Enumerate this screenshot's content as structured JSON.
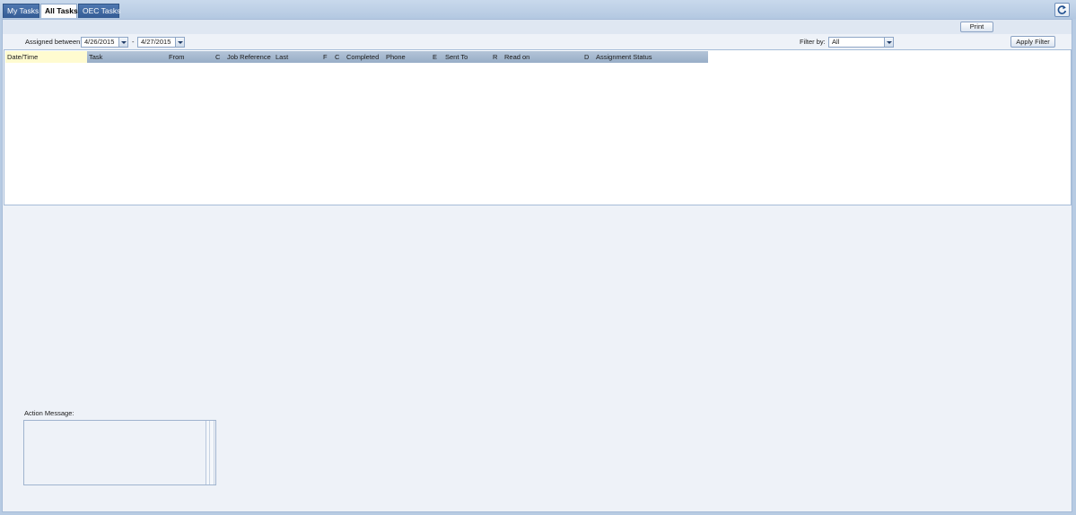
{
  "tabs": [
    {
      "label": "My Tasks",
      "active": false
    },
    {
      "label": "All Tasks",
      "active": true
    },
    {
      "label": "OEC Tasks",
      "active": false
    }
  ],
  "toolbar": {
    "print_label": "Print",
    "refresh_icon": "refresh-icon"
  },
  "filters": {
    "assigned_label": "Assigned between:",
    "date_from": "4/26/2015",
    "separator": "-",
    "date_to": "4/27/2015",
    "filter_by_label": "Filter by:",
    "filter_value": "All",
    "apply_label": "Apply Filter"
  },
  "grid": {
    "columns": [
      "Date/Time",
      "Task",
      "From",
      "C",
      "Job Reference",
      "Last",
      "F",
      "C",
      "Completed",
      "Phone",
      "E",
      "Sent To",
      "R",
      "Read on",
      "D",
      "Assignment Status"
    ],
    "sorted_column": "Date/Time",
    "rows": []
  },
  "action_message": {
    "label": "Action Message:",
    "value": ""
  },
  "colors": {
    "tab_active_bg": "#fdfdfd",
    "tab_bg": "#3f68a3",
    "header_bg": "#a7b9cf",
    "sorted_header_bg": "#fffbd0",
    "content_bg": "#eef2f8",
    "frame_bg": "#b7cbe3"
  }
}
